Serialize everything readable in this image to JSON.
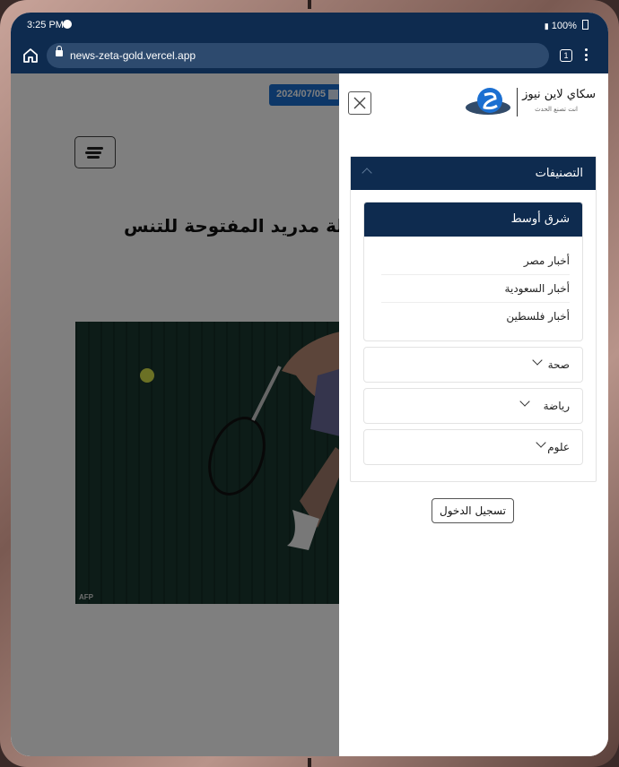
{
  "status_bar": {
    "time": "3:25 PM",
    "battery": "100%"
  },
  "browser": {
    "url": "news-zeta-gold.vercel.app",
    "tab_count": "1"
  },
  "page": {
    "date": "2024/07/05",
    "headline": "لة مدريد المفتوحة للتنس",
    "photo_credit": "AFP"
  },
  "drawer": {
    "logo_name": "سكاي لاين نيوز",
    "logo_tagline": "انت تصنع الحدث",
    "categories_title": "التصنيفات",
    "open_group": {
      "label": "شرق أوسط",
      "items": [
        "أخبار مصر",
        "أخبار السعودية",
        "أخبار فلسطين"
      ]
    },
    "collapsed_groups": [
      "صحة",
      "رياضة",
      "علوم"
    ],
    "login_label": "تسجيل الدخول"
  }
}
